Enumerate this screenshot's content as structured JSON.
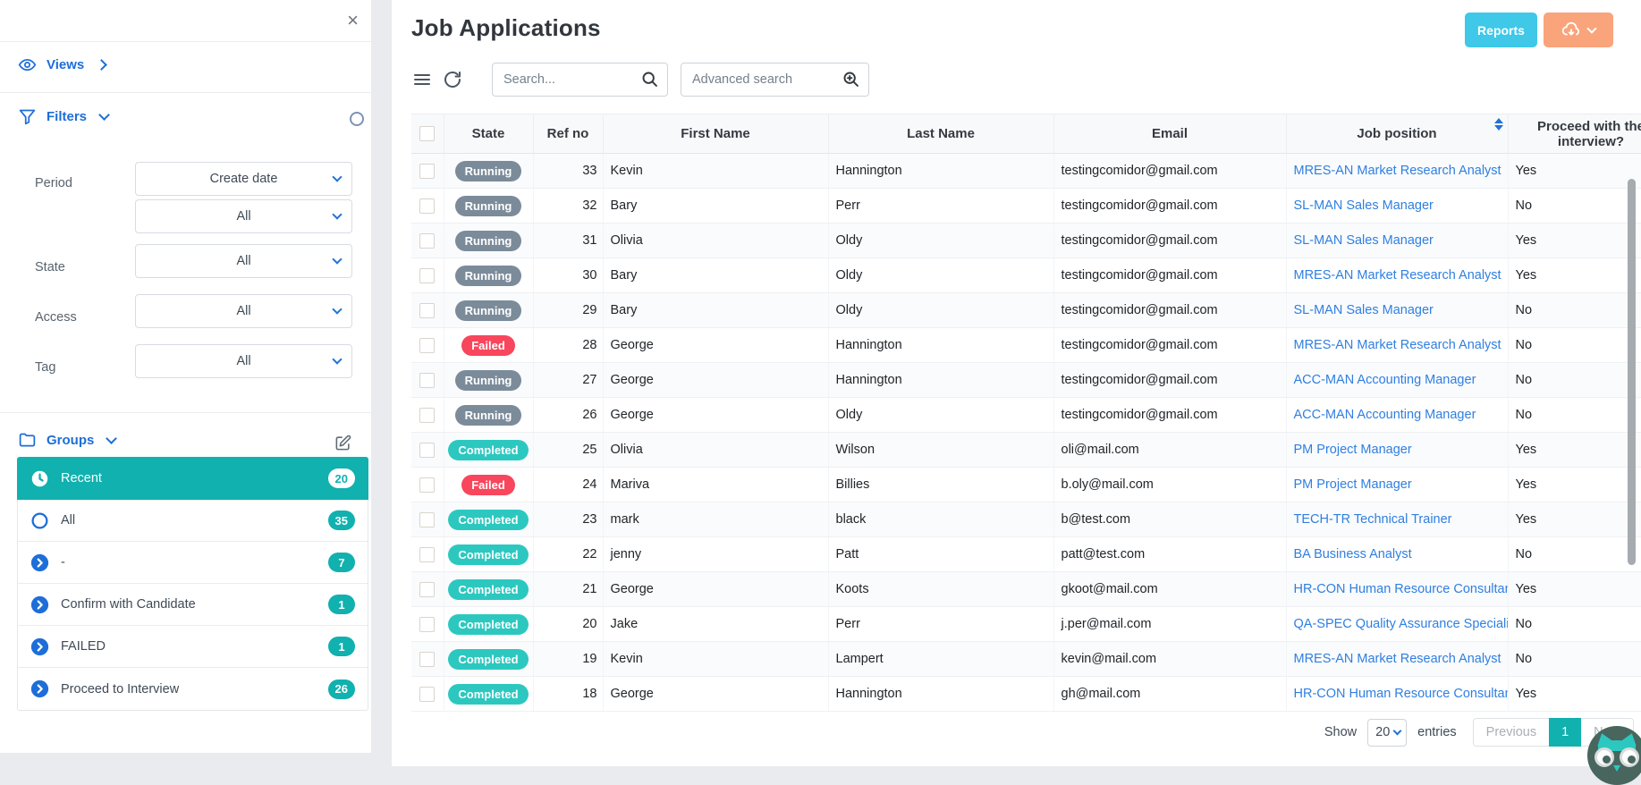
{
  "sidebar": {
    "close_label": "×",
    "views_label": "Views",
    "filters_label": "Filters",
    "filters": [
      {
        "label": "Period",
        "selects": [
          "Create date",
          "All"
        ]
      },
      {
        "label": "State",
        "selects": [
          "All"
        ]
      },
      {
        "label": "Access",
        "selects": [
          "All"
        ]
      },
      {
        "label": "Tag",
        "selects": [
          "All"
        ]
      }
    ],
    "groups_label": "Groups",
    "groups": [
      {
        "label": "Recent",
        "count": "20",
        "icon": "clock-icon",
        "active": true
      },
      {
        "label": "All",
        "count": "35",
        "icon": "circle-icon",
        "active": false
      },
      {
        "label": "-",
        "count": "7",
        "icon": "chevron-circle-icon",
        "active": false
      },
      {
        "label": "Confirm with Candidate",
        "count": "1",
        "icon": "chevron-circle-icon",
        "active": false
      },
      {
        "label": "FAILED",
        "count": "1",
        "icon": "chevron-circle-icon",
        "active": false
      },
      {
        "label": "Proceed to Interview",
        "count": "26",
        "icon": "chevron-circle-icon",
        "active": false
      }
    ]
  },
  "header": {
    "title": "Job Applications",
    "reports_label": "Reports"
  },
  "toolbar": {
    "search_placeholder": "Search...",
    "advanced_search_placeholder": "Advanced search"
  },
  "table": {
    "columns": [
      "State",
      "Ref no",
      "First Name",
      "Last Name",
      "Email",
      "Job position",
      "Proceed with the interview?"
    ],
    "rows": [
      {
        "state": "Running",
        "ref": "33",
        "first": "Kevin",
        "last": "Hannington",
        "email": "testingcomidor@gmail.com",
        "job": "MRES-AN Market Research Analyst",
        "proceed": "Yes"
      },
      {
        "state": "Running",
        "ref": "32",
        "first": "Bary",
        "last": "Perr",
        "email": "testingcomidor@gmail.com",
        "job": "SL-MAN Sales Manager",
        "proceed": "No"
      },
      {
        "state": "Running",
        "ref": "31",
        "first": "Olivia",
        "last": "Oldy",
        "email": "testingcomidor@gmail.com",
        "job": "SL-MAN Sales Manager",
        "proceed": "Yes"
      },
      {
        "state": "Running",
        "ref": "30",
        "first": "Bary",
        "last": "Oldy",
        "email": "testingcomidor@gmail.com",
        "job": "MRES-AN Market Research Analyst",
        "proceed": "Yes"
      },
      {
        "state": "Running",
        "ref": "29",
        "first": "Bary",
        "last": "Oldy",
        "email": "testingcomidor@gmail.com",
        "job": "SL-MAN Sales Manager",
        "proceed": "No"
      },
      {
        "state": "Failed",
        "ref": "28",
        "first": "George",
        "last": "Hannington",
        "email": "testingcomidor@gmail.com",
        "job": "MRES-AN Market Research Analyst",
        "proceed": "No"
      },
      {
        "state": "Running",
        "ref": "27",
        "first": "George",
        "last": "Hannington",
        "email": "testingcomidor@gmail.com",
        "job": "ACC-MAN Accounting Manager",
        "proceed": "No"
      },
      {
        "state": "Running",
        "ref": "26",
        "first": "George",
        "last": "Oldy",
        "email": "testingcomidor@gmail.com",
        "job": "ACC-MAN Accounting Manager",
        "proceed": "No"
      },
      {
        "state": "Completed",
        "ref": "25",
        "first": "Olivia",
        "last": "Wilson",
        "email": "oli@mail.com",
        "job": "PM Project Manager",
        "proceed": "Yes"
      },
      {
        "state": "Failed",
        "ref": "24",
        "first": "Mariva",
        "last": "Billies",
        "email": "b.oly@mail.com",
        "job": "PM Project Manager",
        "proceed": "Yes"
      },
      {
        "state": "Completed",
        "ref": "23",
        "first": "mark",
        "last": "black",
        "email": "b@test.com",
        "job": "TECH-TR Technical Trainer",
        "proceed": "Yes"
      },
      {
        "state": "Completed",
        "ref": "22",
        "first": "jenny",
        "last": "Patt",
        "email": "patt@test.com",
        "job": "BA Business Analyst",
        "proceed": "No"
      },
      {
        "state": "Completed",
        "ref": "21",
        "first": "George",
        "last": "Koots",
        "email": "gkoot@mail.com",
        "job": "HR-CON Human Resource Consultant",
        "proceed": "Yes"
      },
      {
        "state": "Completed",
        "ref": "20",
        "first": "Jake",
        "last": "Perr",
        "email": "j.per@mail.com",
        "job": "QA-SPEC Quality Assurance Specialist",
        "proceed": "No"
      },
      {
        "state": "Completed",
        "ref": "19",
        "first": "Kevin",
        "last": "Lampert",
        "email": "kevin@mail.com",
        "job": "MRES-AN Market Research Analyst",
        "proceed": "No"
      },
      {
        "state": "Completed",
        "ref": "18",
        "first": "George",
        "last": "Hannington",
        "email": "gh@mail.com",
        "job": "HR-CON Human Resource Consultant",
        "proceed": "Yes"
      }
    ]
  },
  "footer": {
    "show_label": "Show",
    "page_size": "20",
    "entries_label": "entries",
    "previous_label": "Previous",
    "current_page": "1",
    "next_label": "Next"
  },
  "colors": {
    "page_background": "#e9ebef",
    "accent_blue": "#1d6ed8",
    "teal": "#10b1ae",
    "badge_running": "#7b8b9a",
    "badge_failed": "#f8465c",
    "badge_completed": "#2cc8c0",
    "reports_button": "#3fc8e8",
    "export_button": "#f9a47b",
    "link_blue": "#2f7fe0"
  }
}
